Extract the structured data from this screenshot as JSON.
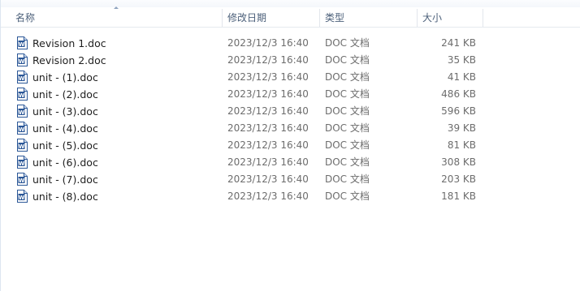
{
  "columns": {
    "name": "名称",
    "date": "修改日期",
    "type": "类型",
    "size": "大小"
  },
  "files": [
    {
      "name": "Revision 1.doc",
      "date": "2023/12/3 16:40",
      "type": "DOC 文档",
      "size": "241 KB",
      "icon": "word-doc-icon"
    },
    {
      "name": "Revision 2.doc",
      "date": "2023/12/3 16:40",
      "type": "DOC 文档",
      "size": "35 KB",
      "icon": "word-doc-icon"
    },
    {
      "name": "unit -  (1).doc",
      "date": "2023/12/3 16:40",
      "type": "DOC 文档",
      "size": "41 KB",
      "icon": "word-doc-icon"
    },
    {
      "name": "unit -  (2).doc",
      "date": "2023/12/3 16:40",
      "type": "DOC 文档",
      "size": "486 KB",
      "icon": "word-doc-icon"
    },
    {
      "name": "unit -  (3).doc",
      "date": "2023/12/3 16:40",
      "type": "DOC 文档",
      "size": "596 KB",
      "icon": "word-doc-icon"
    },
    {
      "name": "unit -  (4).doc",
      "date": "2023/12/3 16:40",
      "type": "DOC 文档",
      "size": "39 KB",
      "icon": "word-doc-icon"
    },
    {
      "name": "unit -  (5).doc",
      "date": "2023/12/3 16:40",
      "type": "DOC 文档",
      "size": "81 KB",
      "icon": "word-doc-icon"
    },
    {
      "name": "unit -  (6).doc",
      "date": "2023/12/3 16:40",
      "type": "DOC 文档",
      "size": "308 KB",
      "icon": "word-doc-icon"
    },
    {
      "name": "unit -  (7).doc",
      "date": "2023/12/3 16:40",
      "type": "DOC 文档",
      "size": "203 KB",
      "icon": "word-doc-icon"
    },
    {
      "name": "unit -  (8).doc",
      "date": "2023/12/3 16:40",
      "type": "DOC 文档",
      "size": "181 KB",
      "icon": "word-doc-icon"
    }
  ],
  "colors": {
    "header_text": "#4c607a",
    "name_text": "#1e1e1e",
    "detail_text": "#6d6d6d",
    "icon_blue": "#2b5797"
  }
}
